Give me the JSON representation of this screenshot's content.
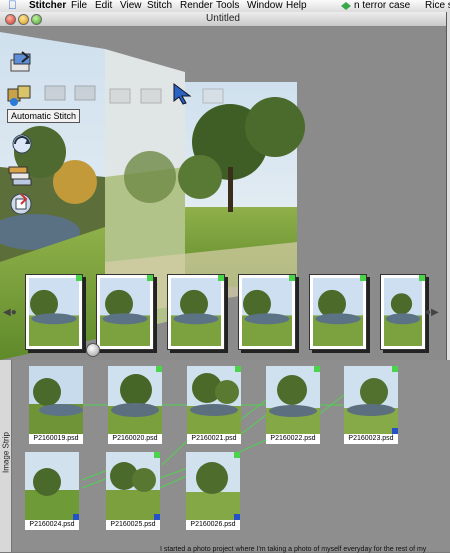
{
  "menubar": {
    "app_name": "Stitcher",
    "items": [
      "File",
      "Edit",
      "View",
      "Stitch",
      "Render",
      "Tools",
      "Window",
      "Help"
    ],
    "tray_text_1": "n terror case",
    "tray_text_2": "Rice sig"
  },
  "window": {
    "title": "Untitled"
  },
  "toolbar": {
    "tooltip": "Automatic Stitch"
  },
  "image_strip": {
    "label": "Image Strip",
    "row1": [
      {
        "caption": "P2160019.psd"
      },
      {
        "caption": "P2160020.psd"
      },
      {
        "caption": "P2160021.psd"
      },
      {
        "caption": "P2160022.psd"
      },
      {
        "caption": "P2160023.psd"
      }
    ],
    "row2": [
      {
        "caption": "P2160024.psd"
      },
      {
        "caption": "P2160025.psd"
      },
      {
        "caption": "P2160026.psd"
      }
    ]
  },
  "background_text": "I started a photo project where I'm taking a photo of myself everyday for the rest of my"
}
